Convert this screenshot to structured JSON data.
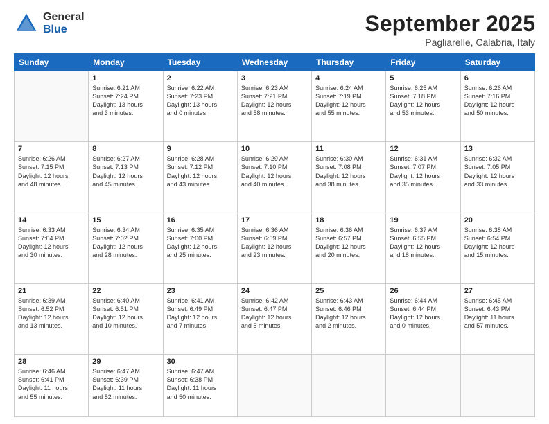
{
  "logo": {
    "general": "General",
    "blue": "Blue"
  },
  "header": {
    "month": "September 2025",
    "location": "Pagliarelle, Calabria, Italy"
  },
  "weekdays": [
    "Sunday",
    "Monday",
    "Tuesday",
    "Wednesday",
    "Thursday",
    "Friday",
    "Saturday"
  ],
  "weeks": [
    [
      {
        "day": "",
        "info": ""
      },
      {
        "day": "1",
        "info": "Sunrise: 6:21 AM\nSunset: 7:24 PM\nDaylight: 13 hours\nand 3 minutes."
      },
      {
        "day": "2",
        "info": "Sunrise: 6:22 AM\nSunset: 7:23 PM\nDaylight: 13 hours\nand 0 minutes."
      },
      {
        "day": "3",
        "info": "Sunrise: 6:23 AM\nSunset: 7:21 PM\nDaylight: 12 hours\nand 58 minutes."
      },
      {
        "day": "4",
        "info": "Sunrise: 6:24 AM\nSunset: 7:19 PM\nDaylight: 12 hours\nand 55 minutes."
      },
      {
        "day": "5",
        "info": "Sunrise: 6:25 AM\nSunset: 7:18 PM\nDaylight: 12 hours\nand 53 minutes."
      },
      {
        "day": "6",
        "info": "Sunrise: 6:26 AM\nSunset: 7:16 PM\nDaylight: 12 hours\nand 50 minutes."
      }
    ],
    [
      {
        "day": "7",
        "info": "Sunrise: 6:26 AM\nSunset: 7:15 PM\nDaylight: 12 hours\nand 48 minutes."
      },
      {
        "day": "8",
        "info": "Sunrise: 6:27 AM\nSunset: 7:13 PM\nDaylight: 12 hours\nand 45 minutes."
      },
      {
        "day": "9",
        "info": "Sunrise: 6:28 AM\nSunset: 7:12 PM\nDaylight: 12 hours\nand 43 minutes."
      },
      {
        "day": "10",
        "info": "Sunrise: 6:29 AM\nSunset: 7:10 PM\nDaylight: 12 hours\nand 40 minutes."
      },
      {
        "day": "11",
        "info": "Sunrise: 6:30 AM\nSunset: 7:08 PM\nDaylight: 12 hours\nand 38 minutes."
      },
      {
        "day": "12",
        "info": "Sunrise: 6:31 AM\nSunset: 7:07 PM\nDaylight: 12 hours\nand 35 minutes."
      },
      {
        "day": "13",
        "info": "Sunrise: 6:32 AM\nSunset: 7:05 PM\nDaylight: 12 hours\nand 33 minutes."
      }
    ],
    [
      {
        "day": "14",
        "info": "Sunrise: 6:33 AM\nSunset: 7:04 PM\nDaylight: 12 hours\nand 30 minutes."
      },
      {
        "day": "15",
        "info": "Sunrise: 6:34 AM\nSunset: 7:02 PM\nDaylight: 12 hours\nand 28 minutes."
      },
      {
        "day": "16",
        "info": "Sunrise: 6:35 AM\nSunset: 7:00 PM\nDaylight: 12 hours\nand 25 minutes."
      },
      {
        "day": "17",
        "info": "Sunrise: 6:36 AM\nSunset: 6:59 PM\nDaylight: 12 hours\nand 23 minutes."
      },
      {
        "day": "18",
        "info": "Sunrise: 6:36 AM\nSunset: 6:57 PM\nDaylight: 12 hours\nand 20 minutes."
      },
      {
        "day": "19",
        "info": "Sunrise: 6:37 AM\nSunset: 6:55 PM\nDaylight: 12 hours\nand 18 minutes."
      },
      {
        "day": "20",
        "info": "Sunrise: 6:38 AM\nSunset: 6:54 PM\nDaylight: 12 hours\nand 15 minutes."
      }
    ],
    [
      {
        "day": "21",
        "info": "Sunrise: 6:39 AM\nSunset: 6:52 PM\nDaylight: 12 hours\nand 13 minutes."
      },
      {
        "day": "22",
        "info": "Sunrise: 6:40 AM\nSunset: 6:51 PM\nDaylight: 12 hours\nand 10 minutes."
      },
      {
        "day": "23",
        "info": "Sunrise: 6:41 AM\nSunset: 6:49 PM\nDaylight: 12 hours\nand 7 minutes."
      },
      {
        "day": "24",
        "info": "Sunrise: 6:42 AM\nSunset: 6:47 PM\nDaylight: 12 hours\nand 5 minutes."
      },
      {
        "day": "25",
        "info": "Sunrise: 6:43 AM\nSunset: 6:46 PM\nDaylight: 12 hours\nand 2 minutes."
      },
      {
        "day": "26",
        "info": "Sunrise: 6:44 AM\nSunset: 6:44 PM\nDaylight: 12 hours\nand 0 minutes."
      },
      {
        "day": "27",
        "info": "Sunrise: 6:45 AM\nSunset: 6:43 PM\nDaylight: 11 hours\nand 57 minutes."
      }
    ],
    [
      {
        "day": "28",
        "info": "Sunrise: 6:46 AM\nSunset: 6:41 PM\nDaylight: 11 hours\nand 55 minutes."
      },
      {
        "day": "29",
        "info": "Sunrise: 6:47 AM\nSunset: 6:39 PM\nDaylight: 11 hours\nand 52 minutes."
      },
      {
        "day": "30",
        "info": "Sunrise: 6:47 AM\nSunset: 6:38 PM\nDaylight: 11 hours\nand 50 minutes."
      },
      {
        "day": "",
        "info": ""
      },
      {
        "day": "",
        "info": ""
      },
      {
        "day": "",
        "info": ""
      },
      {
        "day": "",
        "info": ""
      }
    ]
  ]
}
